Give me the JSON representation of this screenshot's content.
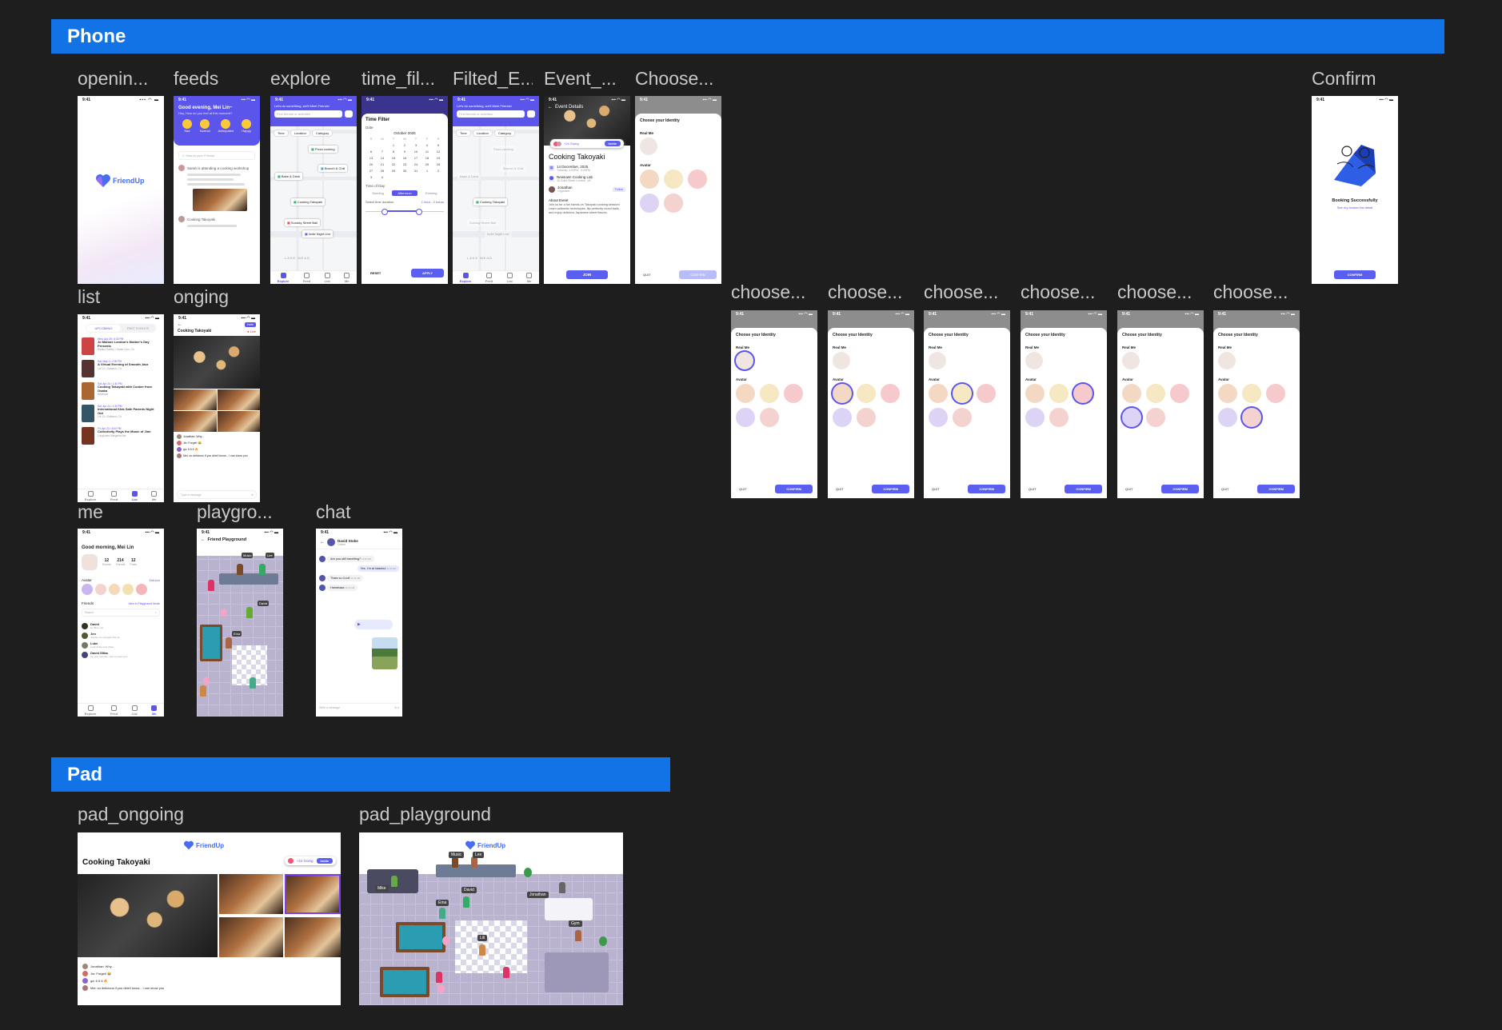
{
  "sections": {
    "phone": "Phone",
    "pad": "Pad"
  },
  "labels": {
    "opening": "openin...",
    "feeds": "feeds",
    "explore": "explore",
    "time_filter": "time_fil...",
    "filtered": "Filted_E...",
    "event": "Event_...",
    "choose": "Choose...",
    "confirm": "Confirm",
    "list": "list",
    "ongoing": "onging",
    "me": "me",
    "playground": "playgro...",
    "chat": "chat",
    "choose_variants": [
      "choose...",
      "choose...",
      "choose...",
      "choose...",
      "choose...",
      "choose..."
    ],
    "pad_ongoing": "pad_ongoing",
    "pad_playground": "pad_playground"
  },
  "status": {
    "time": "9:41",
    "signal": "▪▪▪ ◠ ▬"
  },
  "brand": {
    "name": "FriendUp",
    "logo_icon": "heart-icon"
  },
  "feeds": {
    "greeting": "Good evening, Mei Lin~",
    "subtitle": "Hey, How do you feel at this moment?",
    "moods": [
      "Sad",
      "Normal",
      "Anticipated",
      "Happy"
    ],
    "search_placeholder": "Search your Friends",
    "post_author": "Sarah",
    "post_text": "Sarah is attending a cooking workshop",
    "post_comment": "Cooking Takoyaki"
  },
  "explore": {
    "header": "Let's do something, we'll Meet Friends!",
    "search_placeholder": "Find friends or activities",
    "filters": [
      "Time",
      "Location",
      "Category"
    ],
    "pins": [
      "Pizza cooking",
      "Brunch & Chill",
      "Bake & Drink",
      "Cooking Takoyaki",
      "Sunday Street Ball",
      "Indie Night Live"
    ],
    "map_label": "LAKE MEAD",
    "tabs": [
      "Explore",
      "Feed",
      "List",
      "Me"
    ]
  },
  "time_filter": {
    "title": "Time Filter",
    "date_label": "Date",
    "month": "October 2025",
    "weekdays": [
      "S",
      "M",
      "T",
      "W",
      "T",
      "F",
      "S"
    ],
    "days": [
      "",
      "",
      "1",
      "2",
      "3",
      "4",
      "5",
      "6",
      "7",
      "8",
      "9",
      "10",
      "11",
      "12",
      "13",
      "14",
      "15",
      "16",
      "17",
      "18",
      "19",
      "20",
      "21",
      "22",
      "23",
      "24",
      "25",
      "26",
      "27",
      "28",
      "29",
      "30",
      "31",
      "1",
      "2",
      "3",
      "4"
    ],
    "time_of_day_label": "Time of Day",
    "time_options": [
      "Morning",
      "Afternoon",
      "Evening"
    ],
    "duration_label": "Select time duration",
    "duration_value": "1 hour - 2 hours",
    "reset": "RESET",
    "apply": "APPLY"
  },
  "event": {
    "header": "Event Details",
    "going": "+24 Going",
    "invite": "Invite",
    "title": "Cooking Takoyaki",
    "date": "14 December, 2025",
    "time": "Tuesday, 4:00PM - 9:00PM",
    "venue": "Newtown Cooking Lab",
    "address": "36 Guild Street London, UK",
    "organizer": "Jonathan",
    "organizer_role": "Organizer",
    "follow": "Follow",
    "about_label": "About Event",
    "about_text": "Join us for a fun hands-on Takoyaki cooking session! Learn authentic techniques, flip perfectly round balls, and enjoy delicious Japanese street flavors.",
    "join": "JOIN"
  },
  "choose": {
    "title": "Choose your Identity",
    "real_me": "Real Me",
    "avatar": "Avatar",
    "quit": "QUIT",
    "confirm": "CONFIRM"
  },
  "confirm_screen": {
    "title": "Booking Successfully",
    "link": "See my booked list detail",
    "button": "CONFIRM"
  },
  "list": {
    "tabs": [
      "UPCOMING",
      "PAST EVENTS"
    ],
    "items": [
      {
        "date": "Wed, Apr 28 • 5:30 PM",
        "title": "Jo Malone London's Mother's Day Presents",
        "place": "Radius Gallery • Santa Cruz, CA"
      },
      {
        "date": "Sat, May 1 • 2:00 PM",
        "title": "A Virtual Evening of Smooth Jazz",
        "place": "Lot 13 • Oakland, CA"
      },
      {
        "date": "Sat, Apr 24 • 1:30 PM",
        "title": "Cooking Takoyaki with Cooker from Osaka",
        "place": "Newtown"
      },
      {
        "date": "Sat, Apr 24 • 1:30 PM",
        "title": "International Kids Safe Parents Night Out",
        "place": "Lot 13 • Oakland, CA"
      },
      {
        "date": "Fri, Apr 23 • 6:00 PM",
        "title": "Collectivity Plays the Music of Jimi",
        "place": "Longboard Margarita Bar"
      }
    ]
  },
  "ongoing": {
    "title": "Cooking Takoyaki",
    "live": "Live",
    "comments": [
      {
        "user": "Jonathan",
        "text": "Jonathan: Why..."
      },
      {
        "user": "Jin",
        "text": "Jin: Forget! 😂"
      },
      {
        "user": "Ga",
        "text": "ga: 6 6 6 🔥"
      },
      {
        "user": "Mei",
        "text": "Mei: so delicious if you didn't know... I can show you"
      }
    ],
    "input_placeholder": "Type a message"
  },
  "me": {
    "greeting": "Good morning, Mei Lin",
    "stats": [
      {
        "value": "12",
        "label": "Events"
      },
      {
        "value": "214",
        "label": "Friends"
      },
      {
        "value": "12",
        "label": "Posts"
      }
    ],
    "avatar_label": "Avatar",
    "edit": "Edit icon",
    "friends_label": "Friends",
    "view_playground": "View in Playground Mode",
    "search_placeholder": "Search",
    "friends": [
      {
        "name": "David",
        "status": "Hi, Blue you"
      },
      {
        "name": "Jen",
        "status": "Just let me compare this ok"
      },
      {
        "name": "Luke",
        "status": "Look at the new video"
      },
      {
        "name": "David Sfiba",
        "status": "I'm new member, nice to meet you!"
      }
    ],
    "tabs": [
      "Explore",
      "Feed",
      "List",
      "Me"
    ]
  },
  "playground": {
    "title": "Friend Playground",
    "tags": [
      "Music",
      "Lee",
      "David",
      "Ema"
    ]
  },
  "chat": {
    "name": "David Stoke",
    "status": "Online",
    "messages": [
      {
        "side": "left",
        "text": "Are you still travelling?",
        "time": "11:15 AM"
      },
      {
        "side": "right",
        "text": "Yes, I'm at Istanbul",
        "time": "11:20 AM"
      },
      {
        "side": "left",
        "text": "Thats so Cool!",
        "time": "11:21 AM"
      },
      {
        "side": "left",
        "text": "Hahahaaa",
        "time": "11:22 AM"
      }
    ],
    "input_placeholder": "Write a message"
  },
  "pad_ongoing": {
    "title": "Cooking Takoyaki",
    "going": "+24 Going",
    "invite": "Invite",
    "comments": [
      "Jonathan: Why...",
      "Jin: Forget! 😂",
      "ga: 6 6 6 🔥",
      "Mei: so delicious if you didn't know... I can show you"
    ]
  },
  "pad_playground": {
    "tags": [
      "Music",
      "Lee",
      "Mike",
      "David",
      "Ema",
      "Lili",
      "Jonathan",
      "Gym"
    ]
  },
  "colors": {
    "accent": "#5b55ec",
    "section_bar": "#1273e6",
    "canvas": "#1e1e1e"
  }
}
